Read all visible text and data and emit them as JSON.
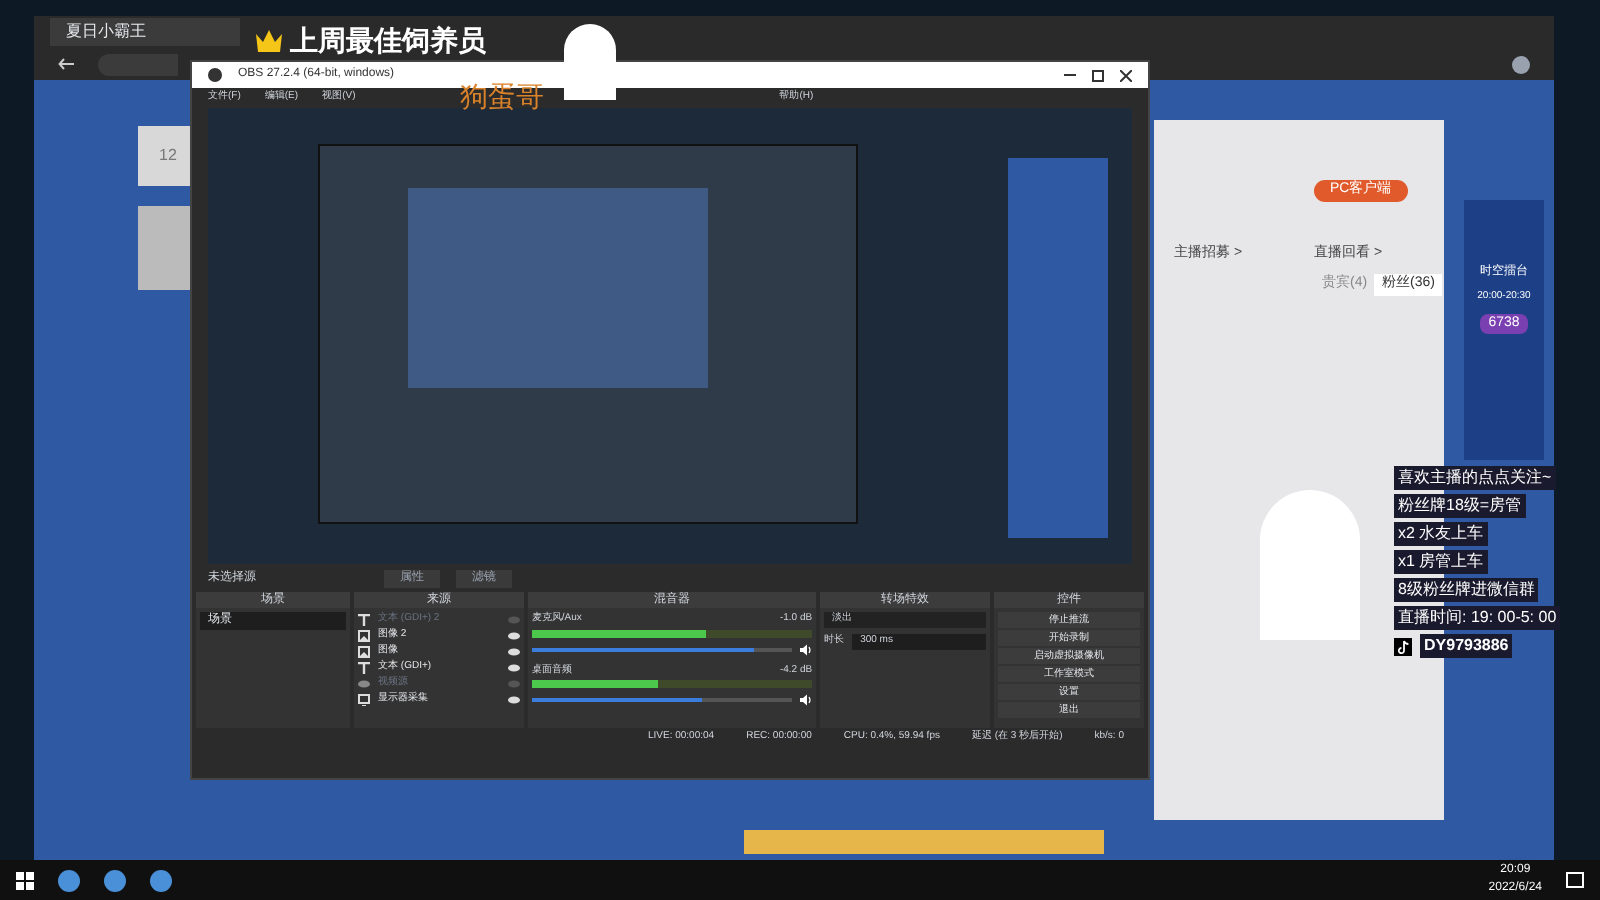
{
  "browser": {
    "tab_title": "夏日小霸王"
  },
  "page": {
    "stat": "12",
    "client_button": "PC客户端",
    "links": [
      "主播招募 >",
      "直播回看 >"
    ],
    "tabs": [
      {
        "label": "贵宾(4)",
        "selected": false
      },
      {
        "label": "粉丝(36)",
        "selected": true
      }
    ],
    "event": {
      "title": "时空擂台",
      "time": "20:00-20:30",
      "score": "6738"
    }
  },
  "obs": {
    "title": "OBS 27.2.4 (64-bit, windows)",
    "menu": [
      "文件(F)",
      "编辑(E)",
      "视图(V)",
      "帮助(H)"
    ],
    "no_source": "未选择源",
    "source_buttons": [
      "属性",
      "滤镜"
    ],
    "docks": [
      "场景",
      "来源",
      "混音器",
      "转场特效",
      "控件"
    ],
    "scenes": [
      {
        "label": "场景",
        "selected": true
      }
    ],
    "sources": [
      {
        "kind": "text",
        "label": "文本 (GDI+) 2",
        "visible": false
      },
      {
        "kind": "image",
        "label": "图像 2",
        "visible": true
      },
      {
        "kind": "image",
        "label": "图像",
        "visible": true
      },
      {
        "kind": "text",
        "label": "文本 (GDI+)",
        "visible": true
      },
      {
        "kind": "camera",
        "label": "视频源",
        "visible": false
      },
      {
        "kind": "display",
        "label": "显示器采集",
        "visible": true
      }
    ],
    "mixer": [
      {
        "name": "麦克风/Aux",
        "reading": "-1.0 dB",
        "level": 0.62,
        "volume": {
          "level": 0.85
        }
      },
      {
        "name": "桌面音频",
        "reading": "-4.2 dB",
        "level": 0.45,
        "volume": {
          "level": 0.65
        }
      }
    ],
    "transition": {
      "value": "淡出",
      "duration_label": "时长",
      "duration": "300 ms"
    },
    "controls": [
      "停止推流",
      "开始录制",
      "启动虚拟摄像机",
      "工作室模式",
      "设置",
      "退出"
    ],
    "status": [
      "LIVE: 00:00:04",
      "REC: 00:00:00",
      "CPU: 0.4%, 59.94 fps",
      "延迟 (在 3 秒后开始)",
      "kb/s: 0"
    ]
  },
  "overlay": {
    "badge": "上周最佳饲养员",
    "name": "狗蛋哥",
    "lines": [
      "喜欢主播的点点关注~",
      "粉丝牌18级=房管",
      "x2 水友上车",
      "x1 房管上车",
      "8级粉丝牌进微信群",
      "直播时间: 19: 00-5: 00"
    ],
    "douyin_id": "DY9793886"
  },
  "taskbar": {
    "time": "20:09",
    "date": "2022/6/24"
  }
}
